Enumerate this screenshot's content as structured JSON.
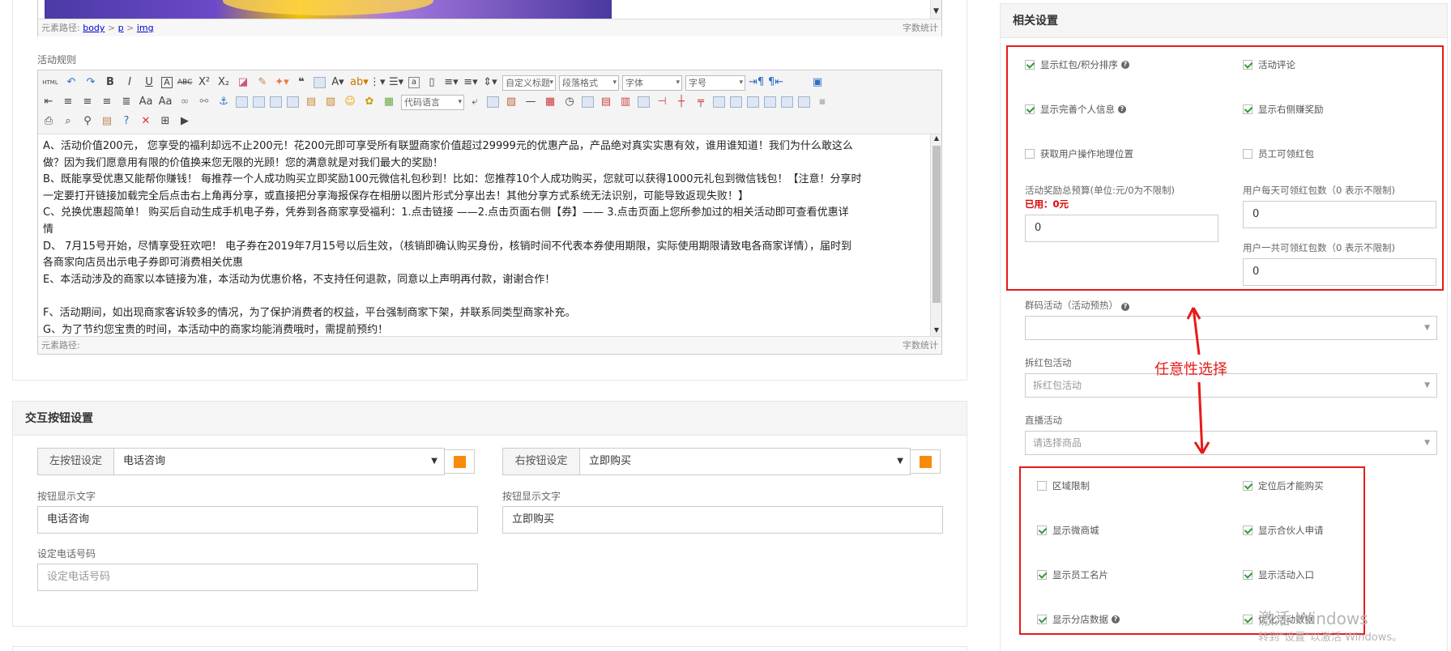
{
  "editor_top": {
    "path_label": "元素路径:",
    "path": [
      "body",
      "p",
      "img"
    ],
    "path_sep": ">",
    "word_count": "字数统计"
  },
  "rules": {
    "label": "活动规则",
    "toolbar": {
      "custom_title": "自定义标题",
      "paragraph": "段落格式",
      "font": "字体",
      "size": "字号",
      "code_lang": "代码语言"
    },
    "lines": [
      "A、活动价值200元， 您享受的福利却远不止200元！花200元即可享受所有联盟商家价值超过29999元的优惠产品，产品绝对真实实惠有效，谁用谁知道！我们为什么敢这么",
      "做？因为我们愿意用有限的价值换来您无限的光顾！您的满意就是对我们最大的奖励！",
      "B、既能享受优惠又能帮你赚钱！ 每推荐一个人成功购买立即奖励100元微信礼包秒到！比如：您推荐10个人成功购买，您就可以获得1000元礼包到微信钱包！【注意！分享时",
      "一定要打开链接加载完全后点击右上角再分享，或直接把分享海报保存在相册以图片形式分享出去！其他分享方式系统无法识别，可能导致返现失败！】",
      "C、兑换优惠超简单！ 购买后自动生成手机电子券，凭券到各商家享受福利：1.点击链接 ——2.点击页面右侧【券】—— 3.点击页面上您所参加过的相关活动即可查看优惠详",
      "情",
      "D、 7月15号开始，尽情享受狂欢吧！ 电子券在2019年7月15号以后生效，（核销即确认购买身份，核销时间不代表本券使用期限，实际使用期限请致电各商家详情），届时到",
      "各商家向店员出示电子券即可消费相关优惠",
      "E、本活动涉及的商家以本链接为准，本活动为优惠价格，不支持任何退款，同意以上声明再付款，谢谢合作！",
      "",
      "F、活动期间，如出现商家客诉较多的情况，为了保护消费者的权益，平台强制商家下架，并联系同类型商家补充。",
      "G、为了节约您宝贵的时间，本活动中的商家均能消费哦时，需提前预约！"
    ],
    "path_label": "元素路径:",
    "word_count": "字数统计"
  },
  "interact": {
    "title": "交互按钮设置",
    "left": {
      "addon": "左按钮设定",
      "value": "电话咨询",
      "color": "#f78b0b"
    },
    "right": {
      "addon": "右按钮设定",
      "value": "立即购买",
      "color": "#f78b0b"
    },
    "left_text_label": "按钮显示文字",
    "left_text": "电话咨询",
    "right_text_label": "按钮显示文字",
    "right_text": "立即购买",
    "phone_label": "设定电话号码",
    "phone_placeholder": "设定电话号码"
  },
  "related": {
    "title": "相关设置",
    "checks_top": [
      {
        "label": "显示红包/积分排序",
        "checked": true,
        "help": true
      },
      {
        "label": "活动评论",
        "checked": true,
        "help": false
      },
      {
        "label": "显示完善个人信息",
        "checked": true,
        "help": true
      },
      {
        "label": "显示右侧赚奖励",
        "checked": true,
        "help": false
      },
      {
        "label": "获取用户操作地理位置",
        "checked": false,
        "help": false
      },
      {
        "label": "员工可领红包",
        "checked": false,
        "help": false
      }
    ],
    "budget_label": "活动奖励总预算(单位:元/0为不限制)",
    "used": "已用：0元",
    "budget_value": "0",
    "daily_label": "用户每天可领红包数（0 表示不限制)",
    "daily_value": "0",
    "total_label": "用户一共可领红包数（0 表示不限制)",
    "total_value": "0",
    "group_label": "群码活动（活动预热）",
    "group_value": "",
    "split_label": "拆红包活动",
    "split_placeholder": "拆红包活动",
    "live_label": "直播活动",
    "live_placeholder": "请选择商品",
    "checks_bottom": [
      {
        "label": "区域限制",
        "checked": false,
        "help": false
      },
      {
        "label": "定位后才能购买",
        "checked": true,
        "help": false
      },
      {
        "label": "显示微商城",
        "checked": true,
        "help": false
      },
      {
        "label": "显示合伙人申请",
        "checked": true,
        "help": false
      },
      {
        "label": "显示员工名片",
        "checked": true,
        "help": false
      },
      {
        "label": "显示活动入口",
        "checked": true,
        "help": false
      },
      {
        "label": "显示分店数据",
        "checked": true,
        "help": true
      },
      {
        "label": "优化活动数据",
        "checked": true,
        "help": false
      }
    ]
  },
  "annotation": {
    "text": "任意性选择",
    "color": "#e81a1a"
  },
  "watermark": {
    "line1": "激活 Windows",
    "line2": "转到\"设置\"以激活 Windows。"
  }
}
